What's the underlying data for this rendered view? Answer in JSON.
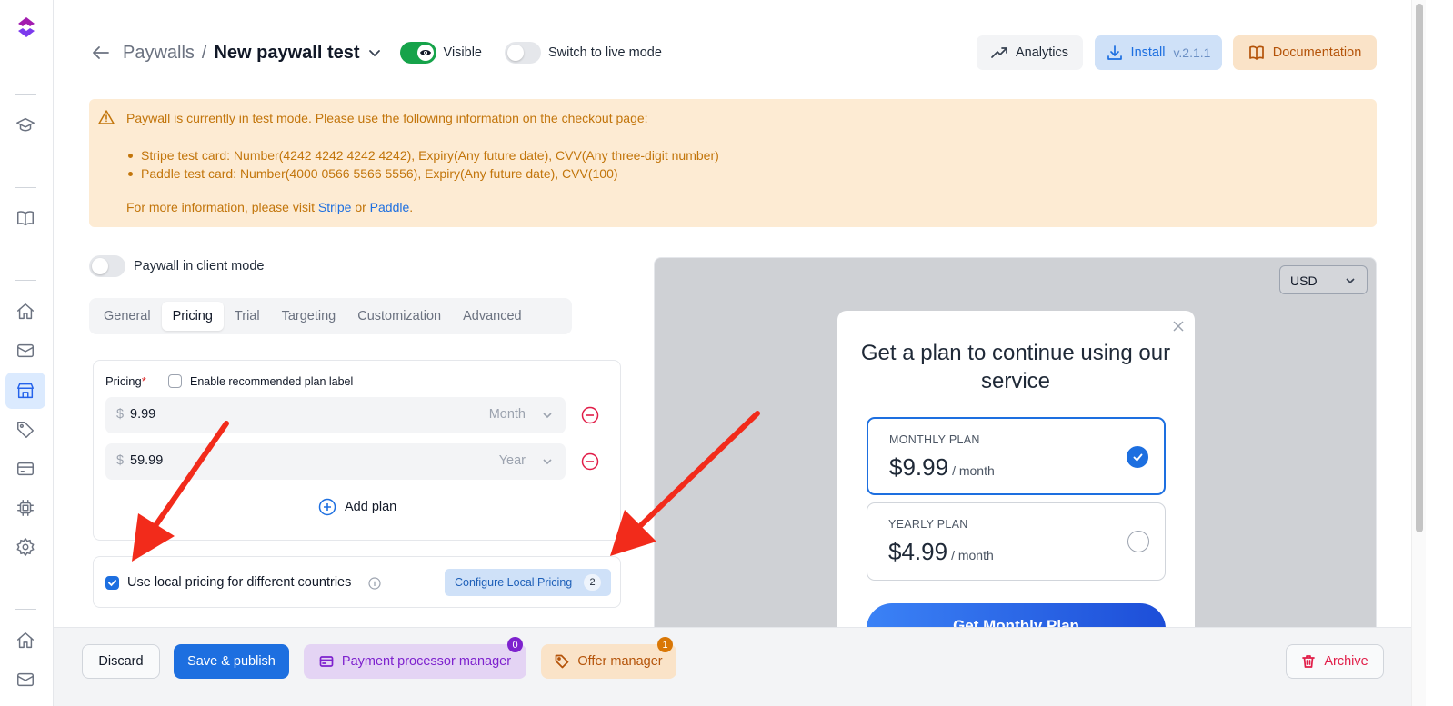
{
  "header": {
    "breadcrumb_parent": "Paywalls",
    "breadcrumb_sep": "/",
    "title": "New paywall test",
    "visible_label": "Visible",
    "visible_on": true,
    "live_mode_label": "Switch to live mode",
    "live_mode_on": false
  },
  "top_actions": {
    "analytics": "Analytics",
    "install": "Install",
    "install_version": "v.2.1.1",
    "documentation": "Documentation"
  },
  "alert": {
    "title": "Paywall is currently in test mode. Please use the following information on the checkout page:",
    "items": [
      "Stripe test card: Number(4242 4242 4242 4242), Expiry(Any future date), CVV(Any three-digit number)",
      "Paddle test card: Number(4000 0566 5566 5556), Expiry(Any future date), CVV(100)"
    ],
    "more_prefix": "For more information, please visit",
    "link_stripe": "Stripe",
    "or": "or",
    "link_paddle": "Paddle",
    "suffix": "."
  },
  "client_mode": {
    "label": "Paywall in client mode",
    "on": false
  },
  "tabs": [
    {
      "label": "General",
      "active": false
    },
    {
      "label": "Pricing",
      "active": true
    },
    {
      "label": "Trial",
      "active": false
    },
    {
      "label": "Targeting",
      "active": false
    },
    {
      "label": "Customization",
      "active": false
    },
    {
      "label": "Advanced",
      "active": false
    }
  ],
  "pricing": {
    "label": "Pricing",
    "required_mark": "*",
    "recommended_label": "Enable recommended plan label",
    "recommended_checked": false,
    "rows": [
      {
        "currency": "$",
        "value": "9.99",
        "period": "Month"
      },
      {
        "currency": "$",
        "value": "59.99",
        "period": "Year"
      }
    ],
    "add_plan": "Add plan"
  },
  "local_pricing": {
    "label": "Use local pricing for different countries",
    "checked": true,
    "button": "Configure Local Pricing",
    "count": "2"
  },
  "preview": {
    "currency": "USD",
    "title": "Get a plan to continue using our service",
    "plans": [
      {
        "name": "MONTHLY PLAN",
        "price": "$9.99",
        "period": "/ month",
        "selected": true
      },
      {
        "name": "YEARLY PLAN",
        "price": "$4.99",
        "period": "/ month",
        "selected": false
      }
    ],
    "cta": "Get Monthly Plan"
  },
  "footer": {
    "discard": "Discard",
    "save": "Save & publish",
    "payment_manager": "Payment processor manager",
    "payment_badge": "0",
    "offer_manager": "Offer manager",
    "offer_badge": "1",
    "archive": "Archive"
  },
  "icons": [
    "logo-icon",
    "graduation-cap-icon",
    "book-icon",
    "home-icon",
    "mail-icon",
    "store-icon",
    "tag-icon",
    "credit-card-icon",
    "chip-icon",
    "gear-icon",
    "arrow-left-icon",
    "chevron-down-icon",
    "eye-icon",
    "trend-up-icon",
    "download-icon",
    "warning-icon",
    "minus-circle-icon",
    "plus-circle-icon",
    "info-icon",
    "close-icon",
    "check-icon",
    "trash-icon"
  ],
  "colors": {
    "primary": "#1d6fe0",
    "toggle_on": "#16a34a",
    "alert_bg": "#fdebd3",
    "alert_text": "#c2750b",
    "danger": "#e11d48",
    "purple_bg": "#e4d4f4",
    "offer_bg": "#fae3c8",
    "annotation_arrow": "#f22b1b"
  }
}
